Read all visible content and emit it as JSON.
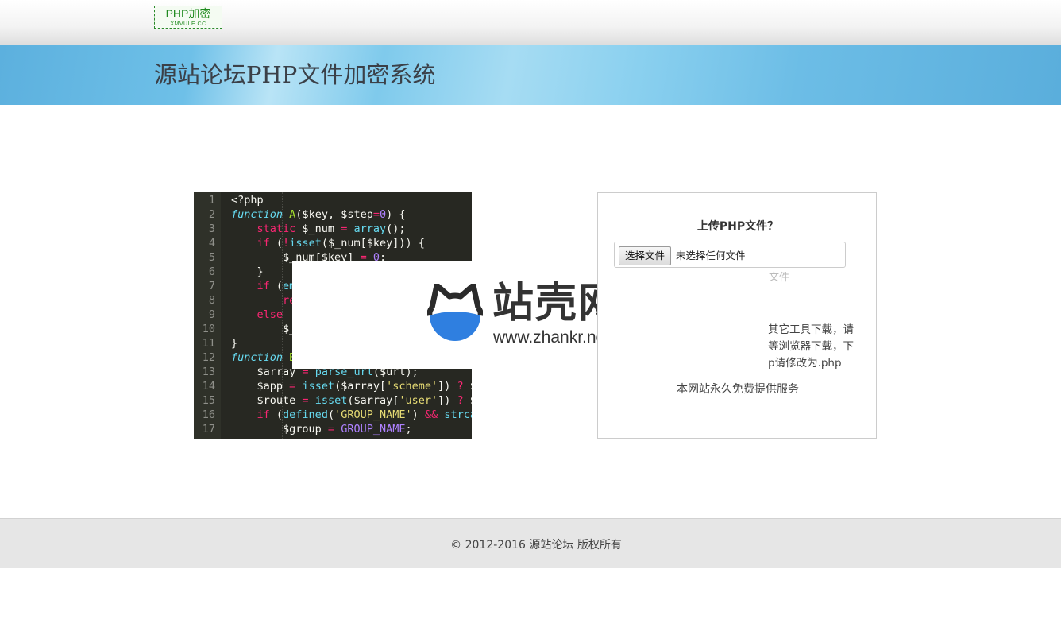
{
  "header": {
    "logo_text": "PHP加密",
    "logo_sub": "XMVULE.CC"
  },
  "banner": {
    "title": "源站论坛PHP文件加密系统"
  },
  "code_lines": [
    {
      "n": "1",
      "html": "&lt;?php"
    },
    {
      "n": "2",
      "html": "<span class='kw'>function</span> <span class='fn'>A</span>($key, $step<span class='op'>=</span><span class='num'>0</span>) {"
    },
    {
      "n": "3",
      "html": "    <span class='op'>static</span> $_num <span class='op'>=</span> <span class='kw' style='font-style:normal'>array</span>();"
    },
    {
      "n": "4",
      "html": "    <span class='op'>if</span> (<span class='op'>!</span><span class='kw' style='font-style:normal'>isset</span>($_num[$key])) {"
    },
    {
      "n": "5",
      "html": "        $_num[$key] <span class='op'>=</span> <span class='num'>0</span>;"
    },
    {
      "n": "6",
      "html": "    }"
    },
    {
      "n": "7",
      "html": "    <span class='op'>if</span> (<span class='kw' style='font-style:normal'>em</span>"
    },
    {
      "n": "8",
      "html": "        <span class='op'>re</span>"
    },
    {
      "n": "9",
      "html": "    <span class='op'>else</span>"
    },
    {
      "n": "10",
      "html": "        $_"
    },
    {
      "n": "11",
      "html": "}"
    },
    {
      "n": "12",
      "html": "<span class='kw'>function</span> <span class='fn'>B</span>"
    },
    {
      "n": "13",
      "html": "    $array <span class='op'>=</span> <span class='kw' style='font-style:normal'>parse_url</span>($url);"
    },
    {
      "n": "14",
      "html": "    $app <span class='op'>=</span> <span class='kw' style='font-style:normal'>isset</span>($array[<span class='str'>'scheme'</span>]) <span class='op'>?</span> $"
    },
    {
      "n": "15",
      "html": "    $route <span class='op'>=</span> <span class='kw' style='font-style:normal'>isset</span>($array[<span class='str'>'user'</span>]) <span class='op'>?</span> $"
    },
    {
      "n": "16",
      "html": "    <span class='op'>if</span> (<span class='kw' style='font-style:normal'>defined</span>(<span class='str'>'GROUP_NAME'</span>) <span class='op'>&amp;&amp;</span> <span class='kw' style='font-style:normal'>strca</span>"
    },
    {
      "n": "17",
      "html": "        $group <span class='op'>=</span> <span class='num'>GROUP_NAME</span>;"
    }
  ],
  "watermark": {
    "name": "站壳网",
    "reg": "®",
    "url": "www.zhankr.net"
  },
  "upload": {
    "title": "上传PHP文件？",
    "file_button": "选择文件",
    "file_status": "未选择任何文件",
    "hint": "文件",
    "notes": [
      "其它工具下载，请",
      "等浏览器下载，下",
      "p请修改为.php"
    ],
    "service": "本网站永久免费提供服务"
  },
  "footer": {
    "copyright": "© 2012-2016 源站论坛 版权所有"
  }
}
